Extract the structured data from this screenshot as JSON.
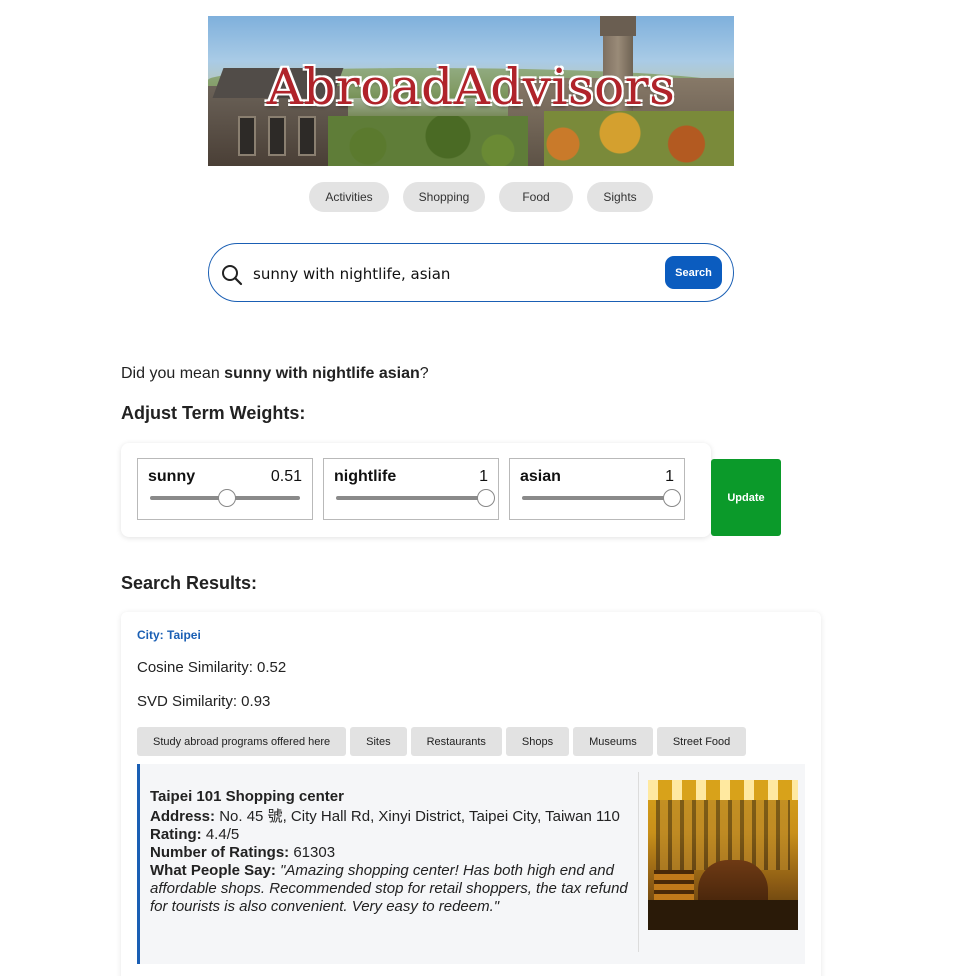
{
  "banner": {
    "title": "AbroadAdvisors"
  },
  "categories": [
    "Activities",
    "Shopping",
    "Food",
    "Sights"
  ],
  "search": {
    "value": "sunny with nightlife, asian",
    "button_label": "Search"
  },
  "suggestion": {
    "prefix": "Did you mean ",
    "term": "sunny with nightlife asian",
    "suffix": "?"
  },
  "weights": {
    "heading": "Adjust Term Weights:",
    "terms": [
      {
        "label": "sunny",
        "value": "0.51",
        "level": 0.51
      },
      {
        "label": "nightlife",
        "value": "1",
        "level": 1
      },
      {
        "label": "asian",
        "value": "1",
        "level": 1
      }
    ],
    "update_label": "Update"
  },
  "results": {
    "heading": "Search Results:",
    "city": "City: Taipei",
    "cosine": "Cosine Similarity: 0.52",
    "svd": "SVD Similarity: 0.93",
    "chips": [
      "Study abroad programs offered here",
      "Sites",
      "Restaurants",
      "Shops",
      "Museums",
      "Street Food"
    ],
    "place": {
      "name": "Taipei 101 Shopping center",
      "address_label": "Address:",
      "address": "No. 45 號, City Hall Rd, Xinyi District, Taipei City, Taiwan 110",
      "rating_label": "Rating:",
      "rating": "4.4/5",
      "num_label": "Number of Ratings:",
      "num": "61303",
      "say_label": "What People Say:",
      "say": "\"Amazing shopping center! Has both high end and affordable shops. Recommended stop for retail shoppers, the tax refund for tourists is also convenient. Very easy to redeem.\""
    }
  }
}
